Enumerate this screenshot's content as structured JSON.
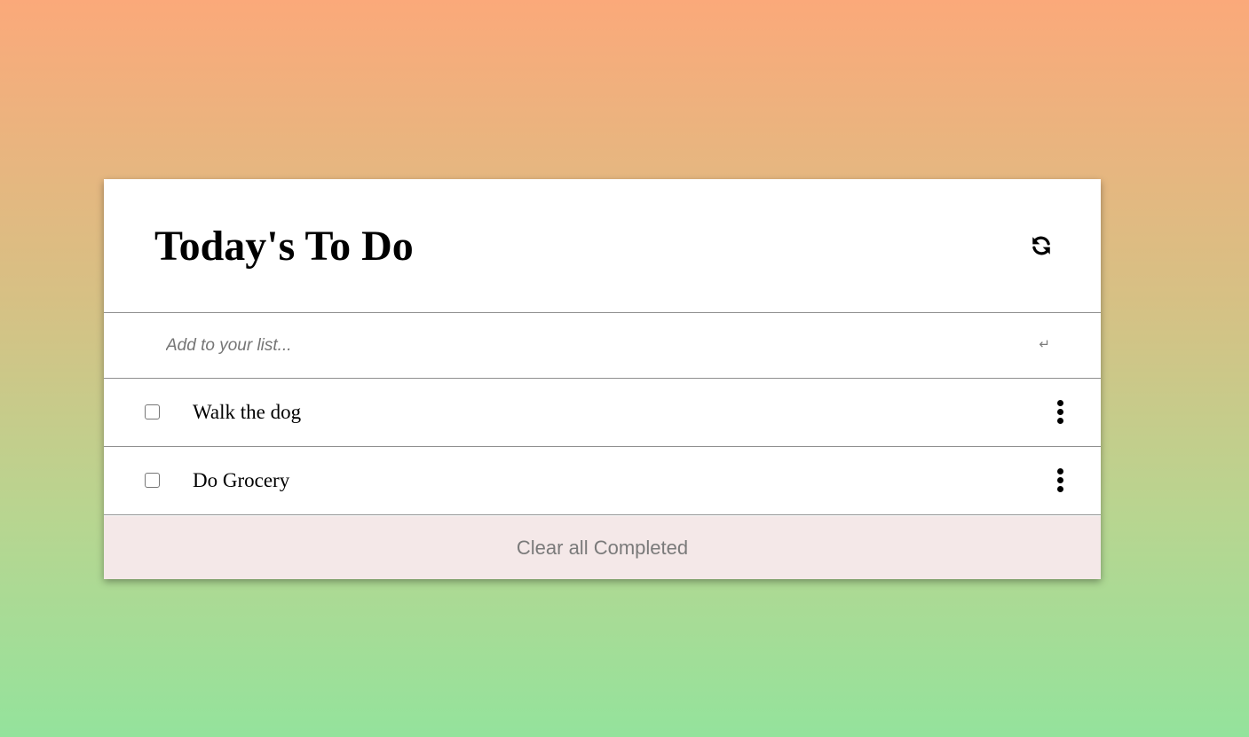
{
  "header": {
    "title": "Today's To Do",
    "refresh_icon": "refresh-icon"
  },
  "add_input": {
    "placeholder": "Add to your list...",
    "value": "",
    "enter_icon": "↵"
  },
  "tasks": [
    {
      "label": "Walk the dog",
      "completed": false
    },
    {
      "label": "Do Grocery",
      "completed": false
    }
  ],
  "footer": {
    "clear_label": "Clear all Completed"
  },
  "colors": {
    "gradient_top": "#fba97a",
    "gradient_bottom": "#94e39c",
    "card": "#ffffff",
    "footer_bg": "#f4e8e8",
    "footer_text": "#7a7a7a"
  }
}
